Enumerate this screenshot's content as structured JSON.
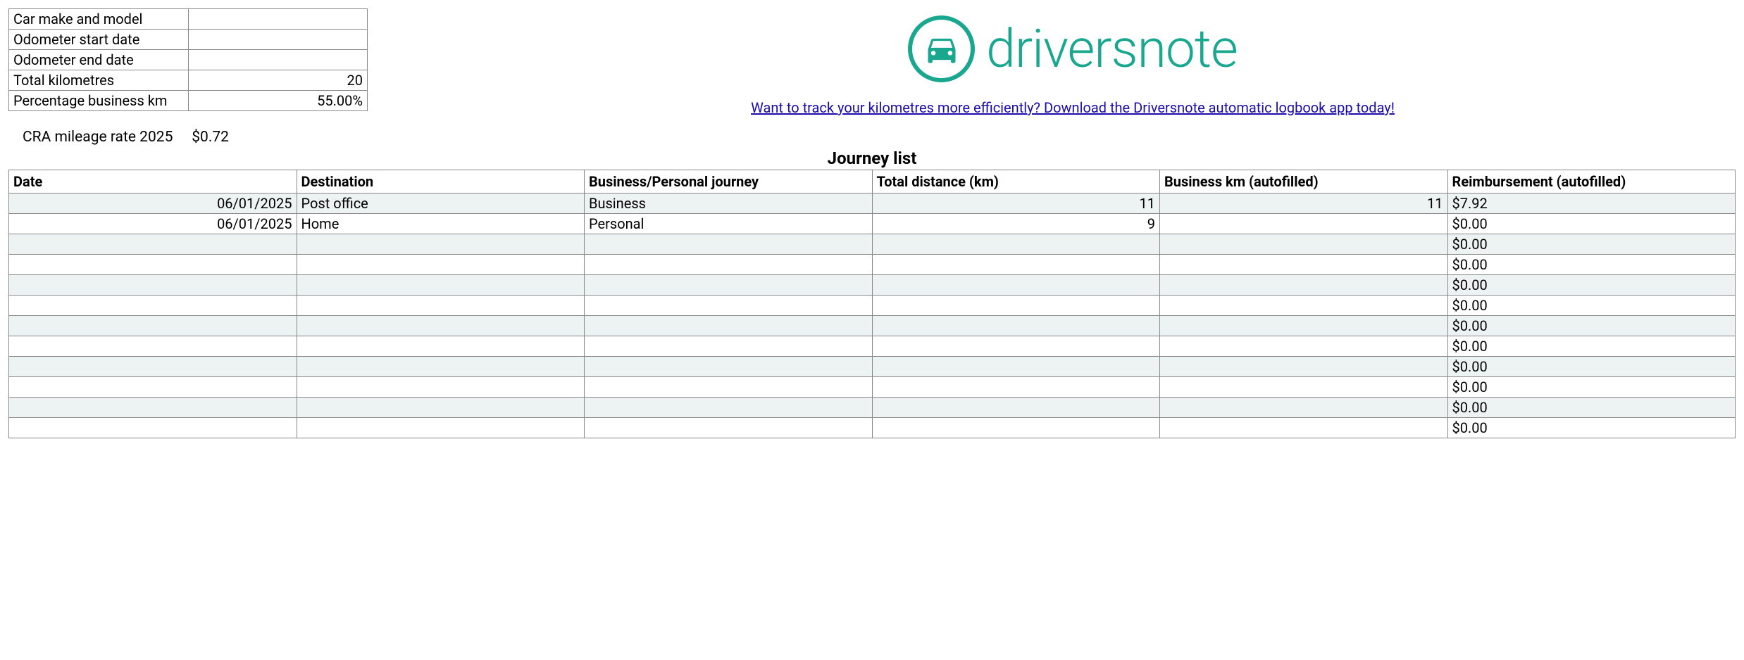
{
  "summary": {
    "rows": [
      {
        "label": "Car make and model",
        "value": ""
      },
      {
        "label": "Odometer start date",
        "value": ""
      },
      {
        "label": "Odometer end date",
        "value": ""
      },
      {
        "label": "Total kilometres",
        "value": "20"
      },
      {
        "label": "Percentage business km",
        "value": "55.00%"
      }
    ]
  },
  "brand": {
    "name": "driversnote"
  },
  "cta": {
    "text": "Want to track your kilometres more efficiently? Download the Driversnote automatic logbook app today!"
  },
  "rate": {
    "label": "CRA mileage rate 2025",
    "value": "$0.72"
  },
  "journey": {
    "title": "Journey list",
    "headers": [
      "Date",
      "Destination",
      "Business/Personal journey",
      "Total distance (km)",
      "Business km (autofilled)",
      "Reimbursement (autofilled)"
    ],
    "rows": [
      {
        "date": "06/01/2025",
        "destination": "Post office",
        "type": "Business",
        "total_distance": "11",
        "business_km": "11",
        "reimbursement": "$7.92"
      },
      {
        "date": "06/01/2025",
        "destination": "Home",
        "type": "Personal",
        "total_distance": "9",
        "business_km": "",
        "reimbursement": "$0.00"
      },
      {
        "date": "",
        "destination": "",
        "type": "",
        "total_distance": "",
        "business_km": "",
        "reimbursement": "$0.00"
      },
      {
        "date": "",
        "destination": "",
        "type": "",
        "total_distance": "",
        "business_km": "",
        "reimbursement": "$0.00"
      },
      {
        "date": "",
        "destination": "",
        "type": "",
        "total_distance": "",
        "business_km": "",
        "reimbursement": "$0.00"
      },
      {
        "date": "",
        "destination": "",
        "type": "",
        "total_distance": "",
        "business_km": "",
        "reimbursement": "$0.00"
      },
      {
        "date": "",
        "destination": "",
        "type": "",
        "total_distance": "",
        "business_km": "",
        "reimbursement": "$0.00"
      },
      {
        "date": "",
        "destination": "",
        "type": "",
        "total_distance": "",
        "business_km": "",
        "reimbursement": "$0.00"
      },
      {
        "date": "",
        "destination": "",
        "type": "",
        "total_distance": "",
        "business_km": "",
        "reimbursement": "$0.00"
      },
      {
        "date": "",
        "destination": "",
        "type": "",
        "total_distance": "",
        "business_km": "",
        "reimbursement": "$0.00"
      },
      {
        "date": "",
        "destination": "",
        "type": "",
        "total_distance": "",
        "business_km": "",
        "reimbursement": "$0.00"
      },
      {
        "date": "",
        "destination": "",
        "type": "",
        "total_distance": "",
        "business_km": "",
        "reimbursement": "$0.00"
      }
    ]
  }
}
